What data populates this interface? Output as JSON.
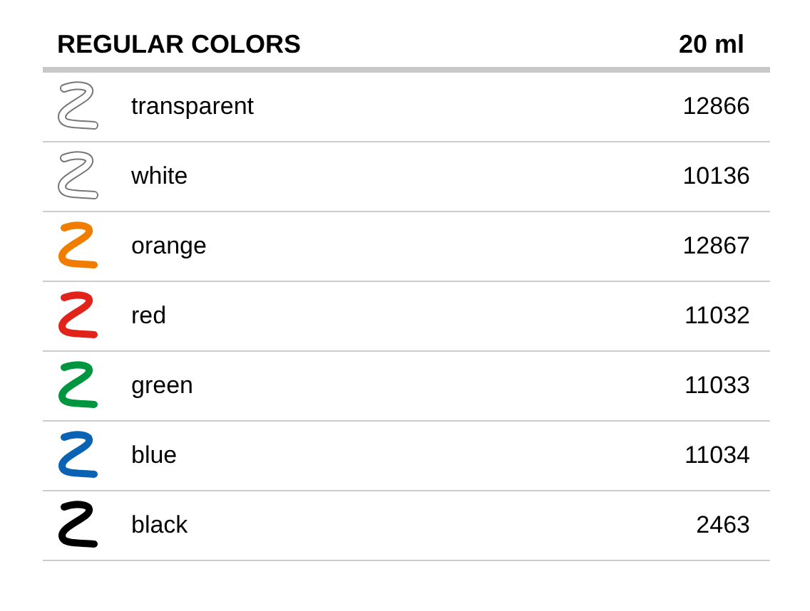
{
  "table": {
    "columns": [
      "REGULAR COLORS",
      "20 ml"
    ],
    "rows": [
      {
        "kind": "outline",
        "name": "transparent",
        "code": "12866"
      },
      {
        "kind": "outline",
        "name": "white",
        "code": "10136"
      },
      {
        "kind": "solid",
        "color": "#f07d00",
        "name": "orange",
        "code": "12867"
      },
      {
        "kind": "solid",
        "color": "#e2231a",
        "name": "red",
        "code": "11032"
      },
      {
        "kind": "solid",
        "color": "#009640",
        "name": "green",
        "code": "11033"
      },
      {
        "kind": "solid",
        "color": "#0a62b4",
        "name": "blue",
        "code": "11034"
      },
      {
        "kind": "solid",
        "color": "#000000",
        "name": "black",
        "code": "2463"
      }
    ]
  }
}
